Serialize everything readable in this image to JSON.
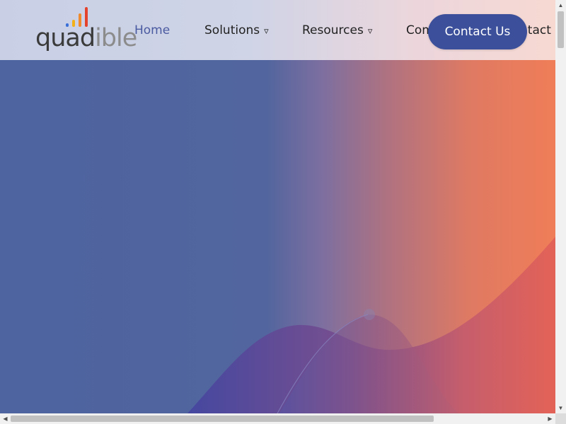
{
  "brand": {
    "logo_text_dark": "quad",
    "logo_text_light": "ible",
    "bar_colors": [
      "#3a6fd8",
      "#f2b019",
      "#f08a2a",
      "#e4422d"
    ]
  },
  "nav": {
    "items": [
      {
        "label": "Home",
        "active": true,
        "dropdown": false
      },
      {
        "label": "Solutions",
        "active": false,
        "dropdown": true
      },
      {
        "label": "Resources",
        "active": false,
        "dropdown": true
      },
      {
        "label": "Com",
        "active": false,
        "dropdown": false
      },
      {
        "label": "ntact",
        "active": false,
        "dropdown": false
      }
    ],
    "caret_icon": "▿"
  },
  "cta": {
    "label": "Contact Us",
    "color": "#3b4f9a"
  },
  "hero": {
    "gradient_colors": [
      "#4d64a0",
      "#52659e",
      "#b07280",
      "#ef7d58"
    ],
    "wave_colors": [
      "#4a4fa0",
      "#df6158"
    ]
  },
  "scrollbars": {
    "up_icon": "▲",
    "down_icon": "▼",
    "left_icon": "◀",
    "right_icon": "▶"
  }
}
